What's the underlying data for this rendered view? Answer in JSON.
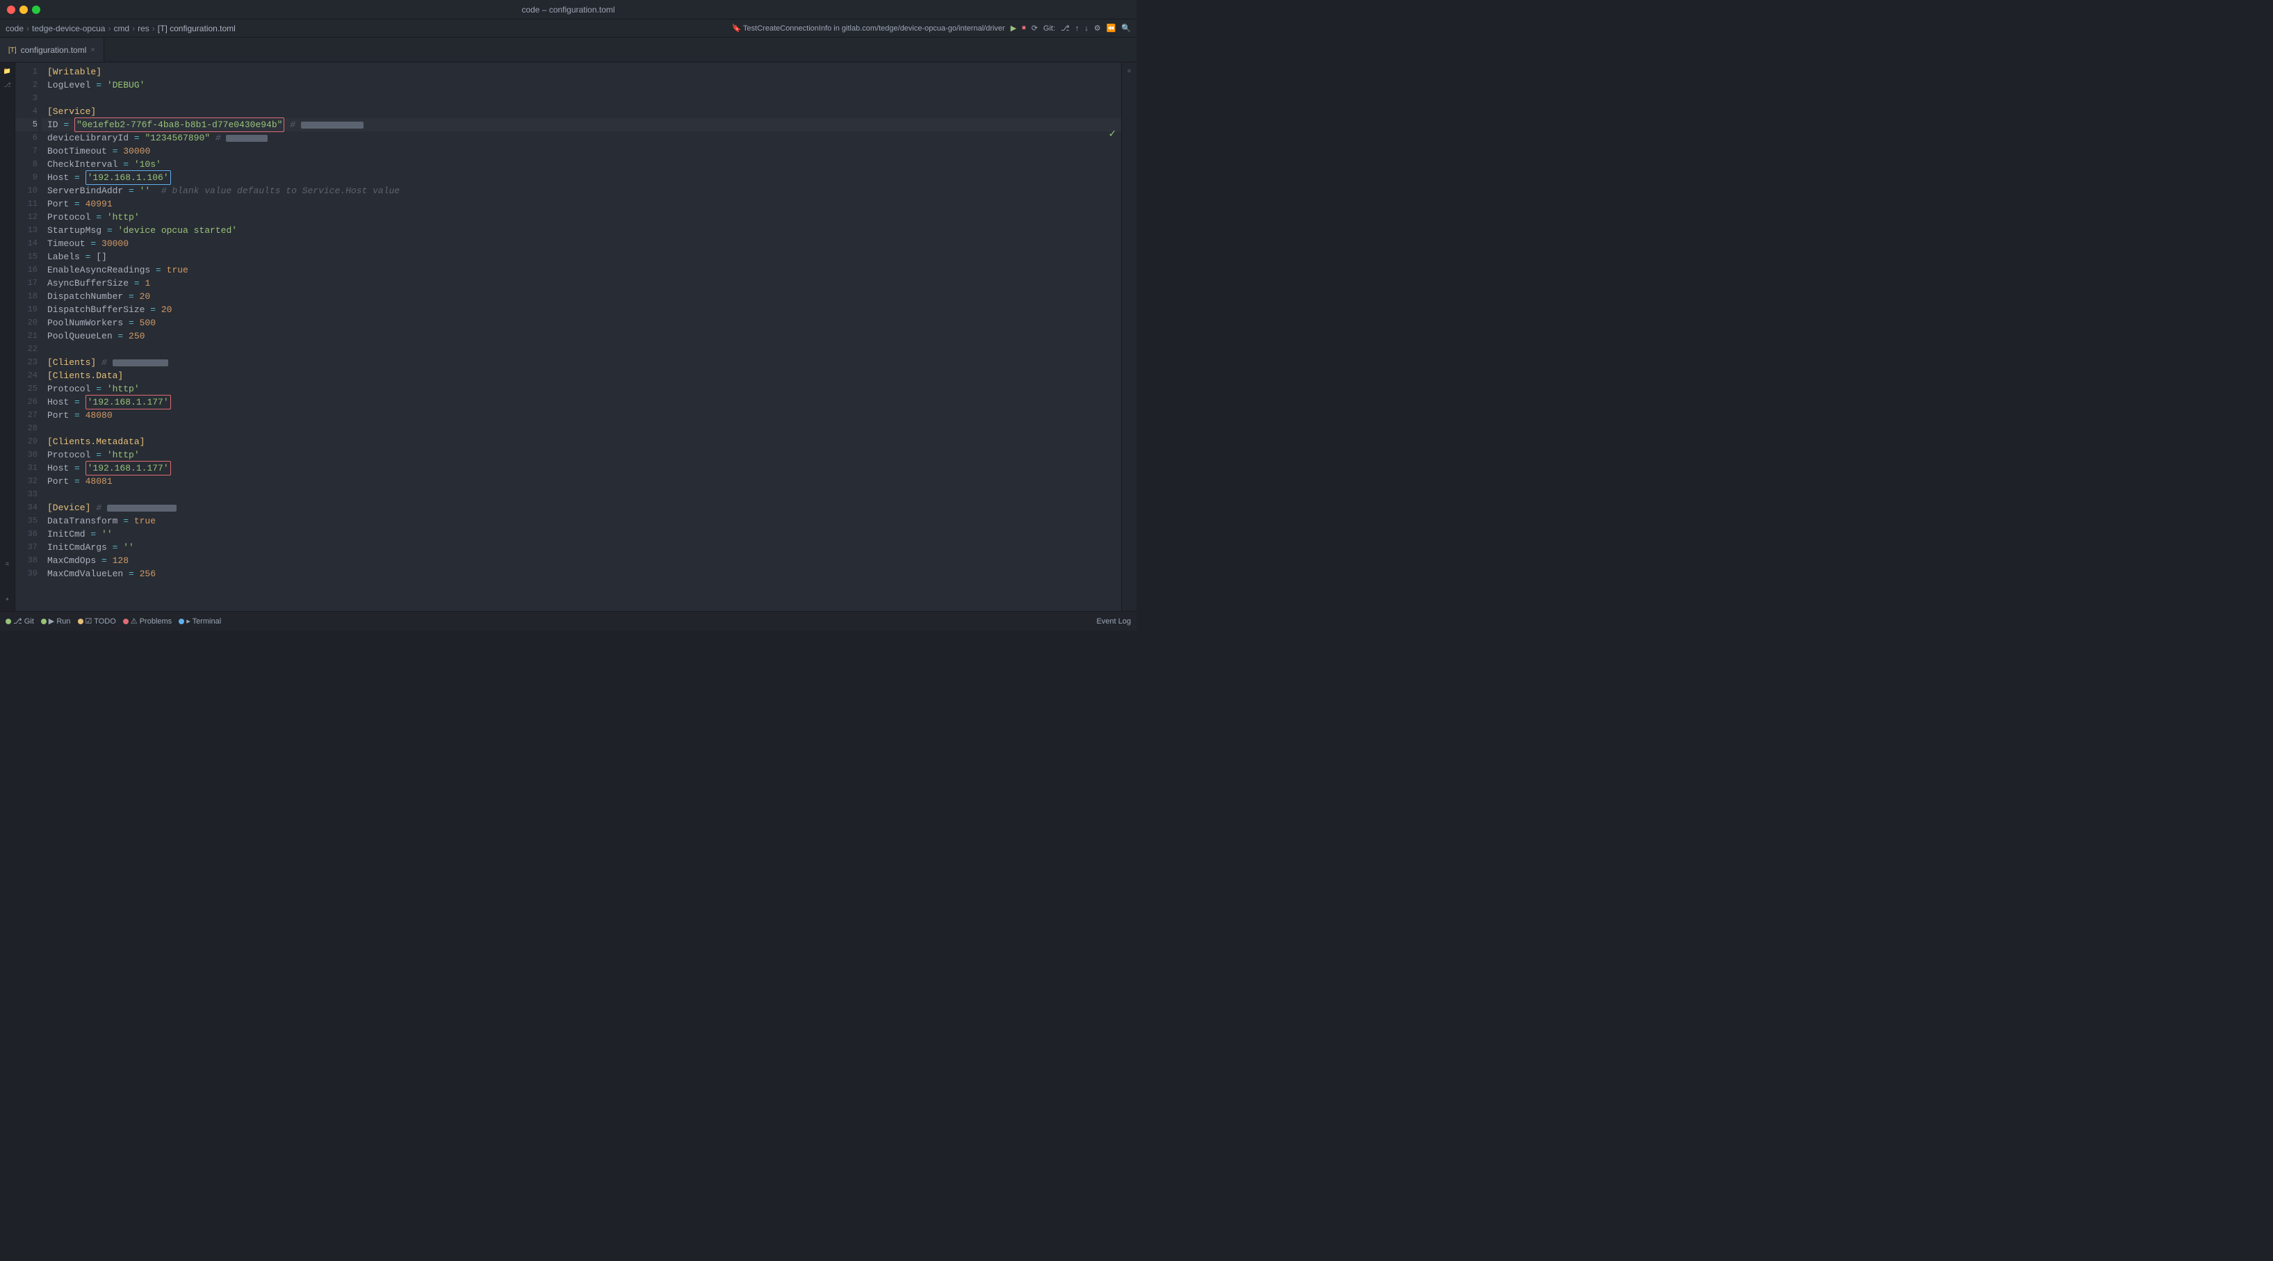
{
  "window": {
    "title": "code – configuration.toml",
    "traffic_lights": [
      "red",
      "yellow",
      "green"
    ]
  },
  "breadcrumb": {
    "items": [
      "code",
      "tedge-device-opcua",
      "cmd",
      "res",
      "[T] configuration.toml"
    ]
  },
  "tab": {
    "icon": "[T]",
    "label": "configuration.toml",
    "close": "×"
  },
  "top_right": {
    "branch": "TestCreateConnectionInfo in gitlab.com/tedge/device-opcua-go/internal/driver",
    "checkmark": "✓"
  },
  "code": {
    "lines": [
      {
        "num": 1,
        "content": "[Writable]",
        "type": "section"
      },
      {
        "num": 2,
        "content": "LogLevel = 'DEBUG'",
        "type": "kv_string"
      },
      {
        "num": 3,
        "content": "",
        "type": "empty"
      },
      {
        "num": 4,
        "content": "[Service]",
        "type": "section"
      },
      {
        "num": 5,
        "content": "ID = \"0e1efeb2-776f-4ba8-b8b1-d77e0430e94b\" # [REDACTED]",
        "type": "kv_string_boxed"
      },
      {
        "num": 6,
        "content": "deviceLibraryId = \"1234567890\" # [REDACTED]",
        "type": "kv_string_redacted"
      },
      {
        "num": 7,
        "content": "BootTimeout = 30000",
        "type": "kv_number"
      },
      {
        "num": 8,
        "content": "CheckInterval = '10s'",
        "type": "kv_string"
      },
      {
        "num": 9,
        "content": "Host = '192.168.1.106'",
        "type": "kv_string_boxed_blue"
      },
      {
        "num": 10,
        "content": "ServerBindAddr = ''  # blank value defaults to Service.Host value",
        "type": "kv_comment"
      },
      {
        "num": 11,
        "content": "Port = 40991",
        "type": "kv_number"
      },
      {
        "num": 12,
        "content": "Protocol = 'http'",
        "type": "kv_string"
      },
      {
        "num": 13,
        "content": "StartupMsg = 'device opcua started'",
        "type": "kv_string"
      },
      {
        "num": 14,
        "content": "Timeout = 30000",
        "type": "kv_number"
      },
      {
        "num": 15,
        "content": "Labels = []",
        "type": "kv_array"
      },
      {
        "num": 16,
        "content": "EnableAsyncReadings = true",
        "type": "kv_bool"
      },
      {
        "num": 17,
        "content": "AsyncBufferSize = 1",
        "type": "kv_number"
      },
      {
        "num": 18,
        "content": "DispatchNumber = 20",
        "type": "kv_number"
      },
      {
        "num": 19,
        "content": "DispatchBufferSize = 20",
        "type": "kv_number"
      },
      {
        "num": 20,
        "content": "PoolNumWorkers = 500",
        "type": "kv_number"
      },
      {
        "num": 21,
        "content": "PoolQueueLen = 250",
        "type": "kv_number"
      },
      {
        "num": 22,
        "content": "",
        "type": "empty"
      },
      {
        "num": 23,
        "content": "[Clients] # [REDACTED]",
        "type": "section_comment"
      },
      {
        "num": 24,
        "content": "[Clients.Data]",
        "type": "section"
      },
      {
        "num": 25,
        "content": "Protocol = 'http'",
        "type": "kv_string"
      },
      {
        "num": 26,
        "content": "Host = '192.168.1.177'",
        "type": "kv_string_boxed_red"
      },
      {
        "num": 27,
        "content": "Port = 48080",
        "type": "kv_number"
      },
      {
        "num": 28,
        "content": "",
        "type": "empty"
      },
      {
        "num": 29,
        "content": "[Clients.Metadata]",
        "type": "section"
      },
      {
        "num": 30,
        "content": "Protocol = 'http'",
        "type": "kv_string"
      },
      {
        "num": 31,
        "content": "Host = '192.168.1.177'",
        "type": "kv_string_boxed_red"
      },
      {
        "num": 32,
        "content": "Port = 48081",
        "type": "kv_number"
      },
      {
        "num": 33,
        "content": "",
        "type": "empty"
      },
      {
        "num": 34,
        "content": "[Device] # [REDACTED]",
        "type": "section_comment"
      },
      {
        "num": 35,
        "content": "DataTransform = true",
        "type": "kv_bool"
      },
      {
        "num": 36,
        "content": "InitCmd = ''",
        "type": "kv_string"
      },
      {
        "num": 37,
        "content": "InitCmdArgs = ''",
        "type": "kv_string"
      },
      {
        "num": 38,
        "content": "MaxCmdOps = 128",
        "type": "kv_number"
      },
      {
        "num": 39,
        "content": "MaxCmdValueLen = 256",
        "type": "kv_number"
      }
    ]
  },
  "status_bar": {
    "left": [
      {
        "icon": "git",
        "label": "Git"
      },
      {
        "icon": "run",
        "label": "Run"
      },
      {
        "icon": "todo",
        "label": "TODO"
      },
      {
        "icon": "problems",
        "label": "Problems"
      },
      {
        "icon": "terminal",
        "label": "Terminal"
      }
    ],
    "right": [
      {
        "label": "Event Log"
      }
    ]
  }
}
